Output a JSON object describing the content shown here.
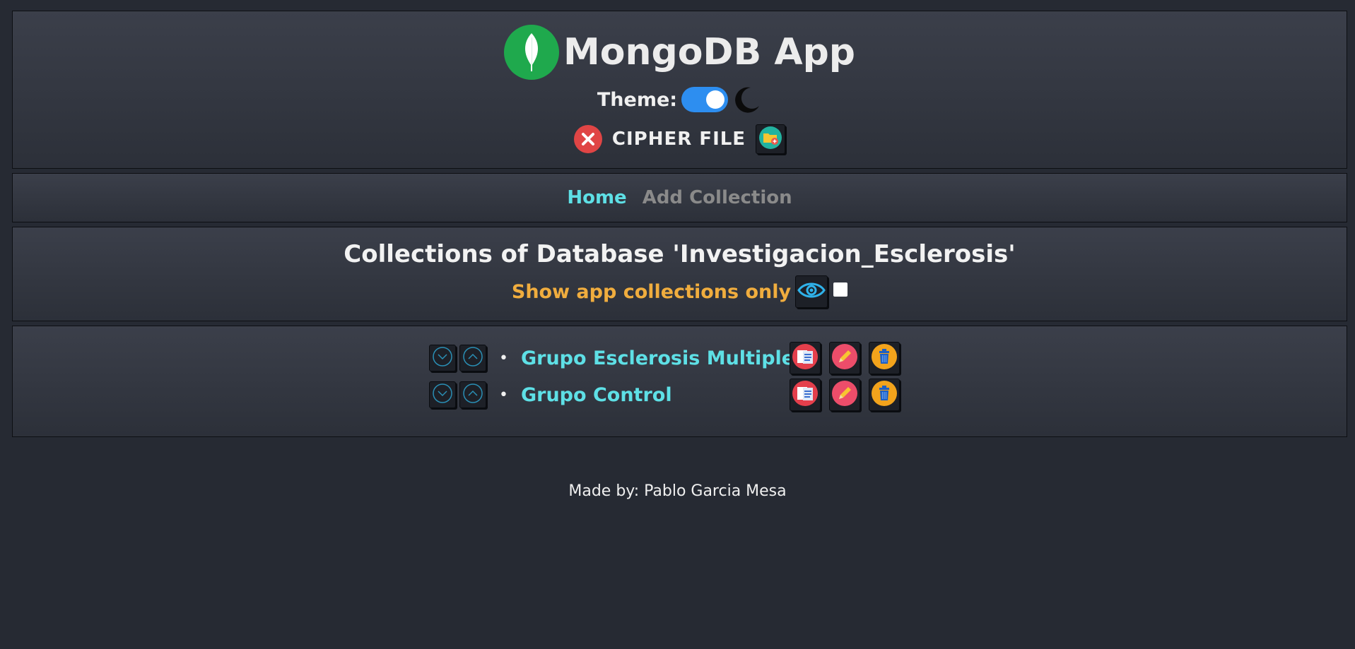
{
  "header": {
    "app_title": "MongoDB App",
    "logo_icon": "mongodb-leaf-icon",
    "theme_label": "Theme:",
    "theme_toggle_state": "dark",
    "theme_icon": "moon-icon",
    "cipher_label": "CIPHER FILE",
    "cipher_status_icon": "close-circle-icon",
    "cipher_add_icon": "folder-add-icon"
  },
  "nav": {
    "home_label": "Home",
    "add_collection_label": "Add Collection"
  },
  "main": {
    "title": "Collections of Database 'Investigacion_Esclerosis'",
    "filter_label": "Show app collections only",
    "filter_icon": "eye-icon",
    "filter_checked": false
  },
  "collections": [
    {
      "name": "Grupo Esclerosis Multiple",
      "actions": [
        "view-documents-icon",
        "edit-icon",
        "delete-icon"
      ]
    },
    {
      "name": "Grupo Control",
      "actions": [
        "view-documents-icon",
        "edit-icon",
        "delete-icon"
      ]
    }
  ],
  "footer": {
    "text": "Made by: Pablo Garcia Mesa"
  },
  "colors": {
    "background": "#262a33",
    "accent_cyan": "#5ee0e6",
    "accent_orange": "#f0ad3e",
    "toggle_blue": "#2d8ef0",
    "logo_green": "#1fa94d"
  }
}
